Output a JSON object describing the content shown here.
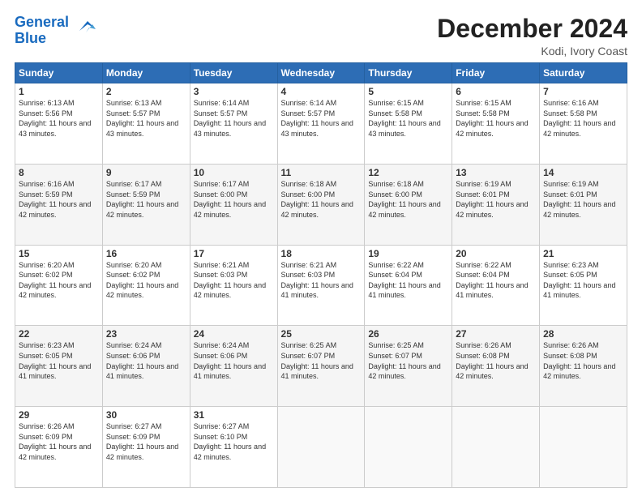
{
  "header": {
    "logo_line1": "General",
    "logo_line2": "Blue",
    "title": "December 2024",
    "location": "Kodi, Ivory Coast"
  },
  "days_of_week": [
    "Sunday",
    "Monday",
    "Tuesday",
    "Wednesday",
    "Thursday",
    "Friday",
    "Saturday"
  ],
  "weeks": [
    [
      {
        "day": "1",
        "sunrise": "6:13 AM",
        "sunset": "5:56 PM",
        "daylight": "11 hours and 43 minutes."
      },
      {
        "day": "2",
        "sunrise": "6:13 AM",
        "sunset": "5:57 PM",
        "daylight": "11 hours and 43 minutes."
      },
      {
        "day": "3",
        "sunrise": "6:14 AM",
        "sunset": "5:57 PM",
        "daylight": "11 hours and 43 minutes."
      },
      {
        "day": "4",
        "sunrise": "6:14 AM",
        "sunset": "5:57 PM",
        "daylight": "11 hours and 43 minutes."
      },
      {
        "day": "5",
        "sunrise": "6:15 AM",
        "sunset": "5:58 PM",
        "daylight": "11 hours and 43 minutes."
      },
      {
        "day": "6",
        "sunrise": "6:15 AM",
        "sunset": "5:58 PM",
        "daylight": "11 hours and 42 minutes."
      },
      {
        "day": "7",
        "sunrise": "6:16 AM",
        "sunset": "5:58 PM",
        "daylight": "11 hours and 42 minutes."
      }
    ],
    [
      {
        "day": "8",
        "sunrise": "6:16 AM",
        "sunset": "5:59 PM",
        "daylight": "11 hours and 42 minutes."
      },
      {
        "day": "9",
        "sunrise": "6:17 AM",
        "sunset": "5:59 PM",
        "daylight": "11 hours and 42 minutes."
      },
      {
        "day": "10",
        "sunrise": "6:17 AM",
        "sunset": "6:00 PM",
        "daylight": "11 hours and 42 minutes."
      },
      {
        "day": "11",
        "sunrise": "6:18 AM",
        "sunset": "6:00 PM",
        "daylight": "11 hours and 42 minutes."
      },
      {
        "day": "12",
        "sunrise": "6:18 AM",
        "sunset": "6:00 PM",
        "daylight": "11 hours and 42 minutes."
      },
      {
        "day": "13",
        "sunrise": "6:19 AM",
        "sunset": "6:01 PM",
        "daylight": "11 hours and 42 minutes."
      },
      {
        "day": "14",
        "sunrise": "6:19 AM",
        "sunset": "6:01 PM",
        "daylight": "11 hours and 42 minutes."
      }
    ],
    [
      {
        "day": "15",
        "sunrise": "6:20 AM",
        "sunset": "6:02 PM",
        "daylight": "11 hours and 42 minutes."
      },
      {
        "day": "16",
        "sunrise": "6:20 AM",
        "sunset": "6:02 PM",
        "daylight": "11 hours and 42 minutes."
      },
      {
        "day": "17",
        "sunrise": "6:21 AM",
        "sunset": "6:03 PM",
        "daylight": "11 hours and 42 minutes."
      },
      {
        "day": "18",
        "sunrise": "6:21 AM",
        "sunset": "6:03 PM",
        "daylight": "11 hours and 41 minutes."
      },
      {
        "day": "19",
        "sunrise": "6:22 AM",
        "sunset": "6:04 PM",
        "daylight": "11 hours and 41 minutes."
      },
      {
        "day": "20",
        "sunrise": "6:22 AM",
        "sunset": "6:04 PM",
        "daylight": "11 hours and 41 minutes."
      },
      {
        "day": "21",
        "sunrise": "6:23 AM",
        "sunset": "6:05 PM",
        "daylight": "11 hours and 41 minutes."
      }
    ],
    [
      {
        "day": "22",
        "sunrise": "6:23 AM",
        "sunset": "6:05 PM",
        "daylight": "11 hours and 41 minutes."
      },
      {
        "day": "23",
        "sunrise": "6:24 AM",
        "sunset": "6:06 PM",
        "daylight": "11 hours and 41 minutes."
      },
      {
        "day": "24",
        "sunrise": "6:24 AM",
        "sunset": "6:06 PM",
        "daylight": "11 hours and 41 minutes."
      },
      {
        "day": "25",
        "sunrise": "6:25 AM",
        "sunset": "6:07 PM",
        "daylight": "11 hours and 41 minutes."
      },
      {
        "day": "26",
        "sunrise": "6:25 AM",
        "sunset": "6:07 PM",
        "daylight": "11 hours and 42 minutes."
      },
      {
        "day": "27",
        "sunrise": "6:26 AM",
        "sunset": "6:08 PM",
        "daylight": "11 hours and 42 minutes."
      },
      {
        "day": "28",
        "sunrise": "6:26 AM",
        "sunset": "6:08 PM",
        "daylight": "11 hours and 42 minutes."
      }
    ],
    [
      {
        "day": "29",
        "sunrise": "6:26 AM",
        "sunset": "6:09 PM",
        "daylight": "11 hours and 42 minutes."
      },
      {
        "day": "30",
        "sunrise": "6:27 AM",
        "sunset": "6:09 PM",
        "daylight": "11 hours and 42 minutes."
      },
      {
        "day": "31",
        "sunrise": "6:27 AM",
        "sunset": "6:10 PM",
        "daylight": "11 hours and 42 minutes."
      },
      null,
      null,
      null,
      null
    ]
  ],
  "labels": {
    "sunrise_prefix": "Sunrise: ",
    "sunset_prefix": "Sunset: ",
    "daylight_prefix": "Daylight: "
  }
}
